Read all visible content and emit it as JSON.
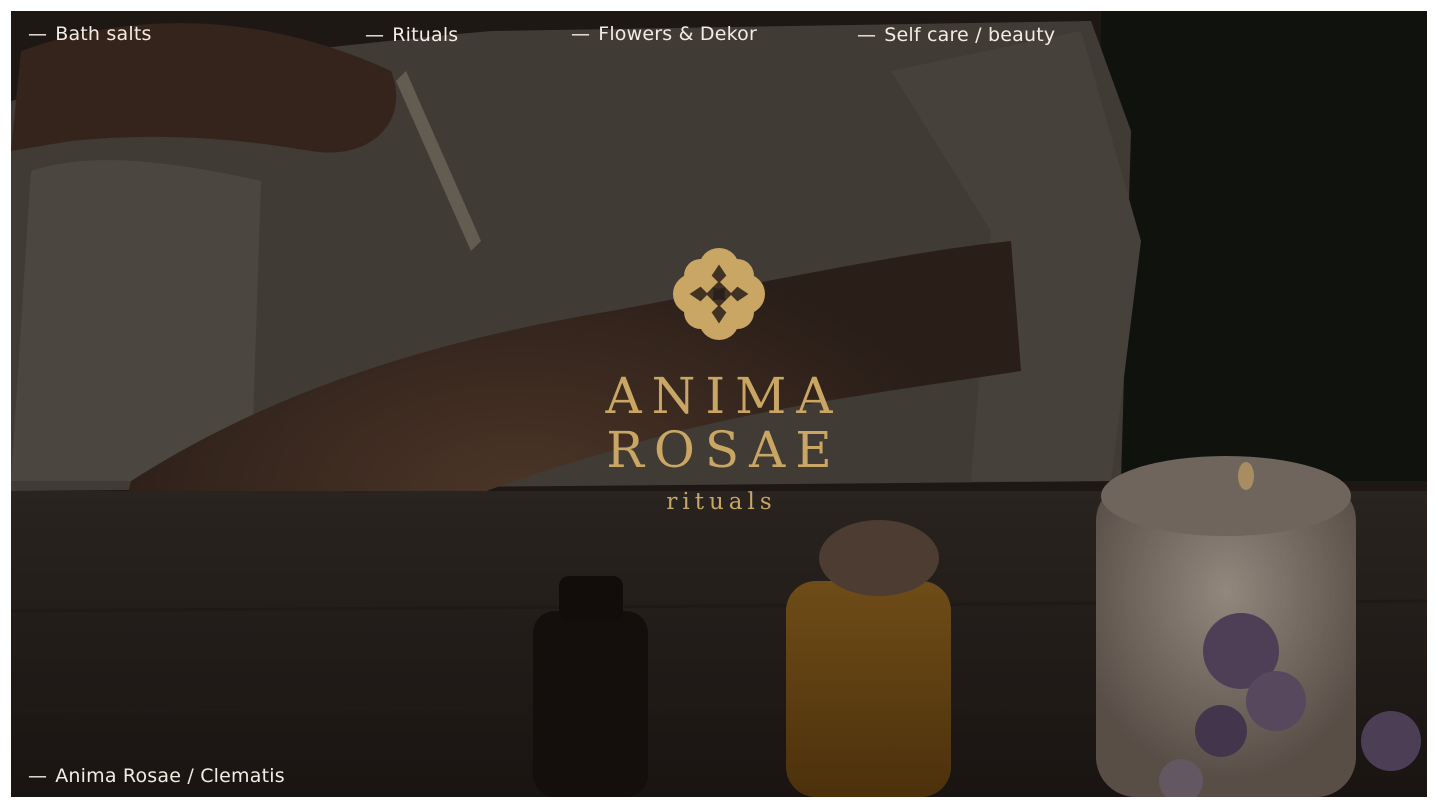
{
  "nav": {
    "items": [
      {
        "dash": "—",
        "label": "Bath salts"
      },
      {
        "dash": "—",
        "label": "Rituals"
      },
      {
        "dash": "—",
        "label": "Flowers & Dekor"
      },
      {
        "dash": "—",
        "label": "Self care / beauty"
      }
    ]
  },
  "brand": {
    "line1": "ANIMA",
    "line2": "ROSAE",
    "tagline": "rituals"
  },
  "caption": {
    "dash": "—",
    "label": "Anima Rosae / Clematis"
  },
  "icons": {
    "emblem": "rose-mandala-logo-icon"
  },
  "colors": {
    "gold": "#c9a663",
    "nav_text": "#f2ece4",
    "background_dark": "#1a1410"
  }
}
